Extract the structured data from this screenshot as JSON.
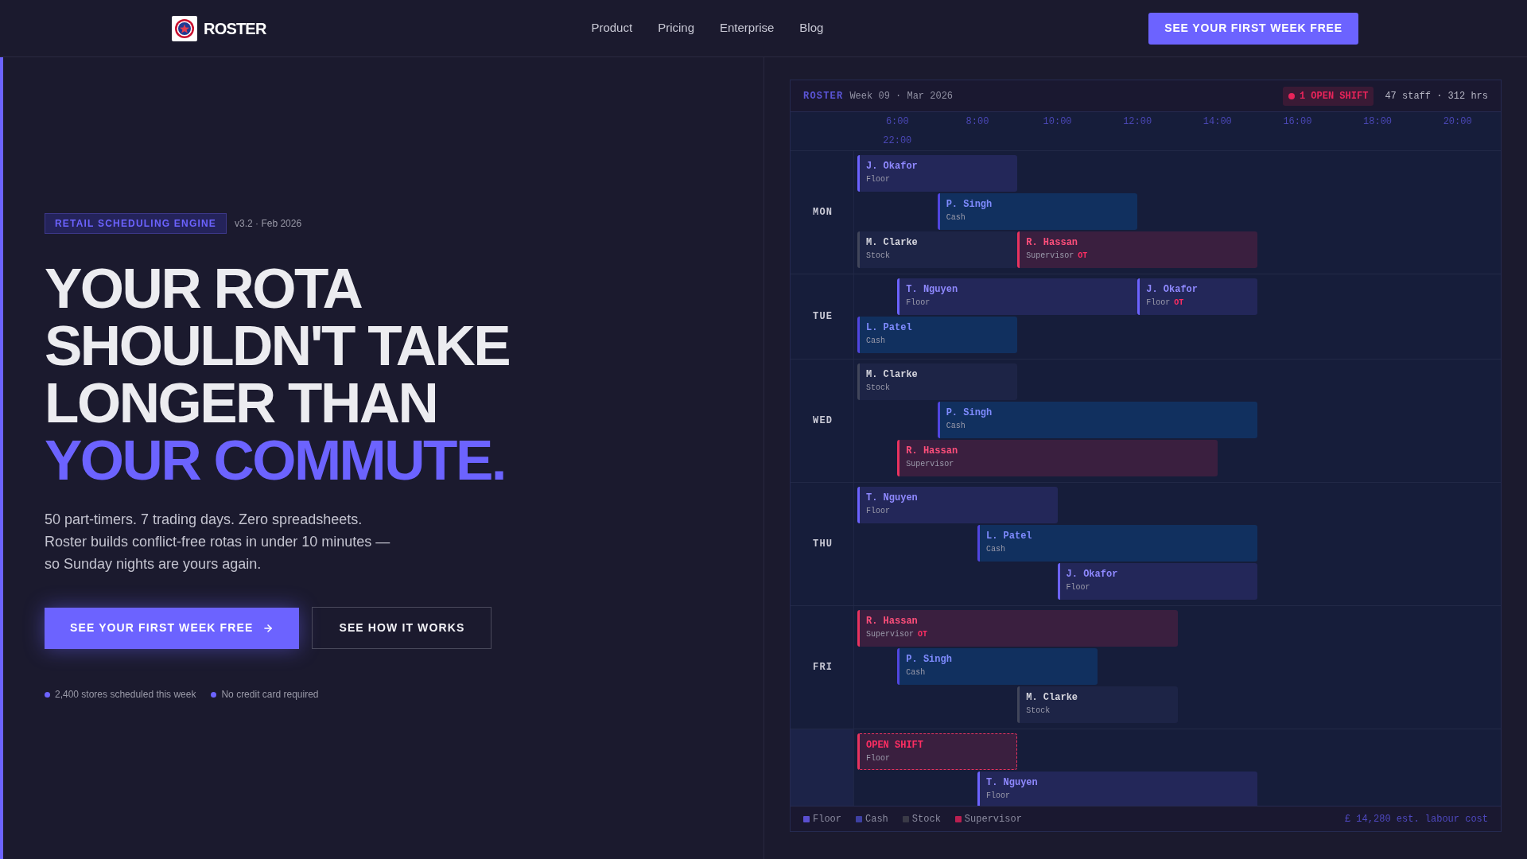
{
  "header": {
    "logo_text": "ROSTER",
    "nav": [
      "Product",
      "Pricing",
      "Enterprise",
      "Blog"
    ],
    "cta": "SEE YOUR FIRST WEEK FREE"
  },
  "hero": {
    "badge": "RETAIL SCHEDULING ENGINE",
    "version": "v3.2 · Feb 2026",
    "headline": [
      {
        "text": "YOUR ROTA",
        "accent": false
      },
      {
        "text": "SHOULDN'T TAKE",
        "accent": false
      },
      {
        "text": "LONGER THAN",
        "accent": false
      },
      {
        "text": "YOUR COMMUTE.",
        "accent": true
      }
    ],
    "description": "50 part-timers. 7 trading days. Zero spreadsheets. Roster builds conflict-free rotas in under 10 minutes — so Sunday nights are yours again.",
    "primary_button": "SEE YOUR FIRST WEEK FREE",
    "secondary_button": "SEE HOW IT WORKS",
    "highlights": [
      "2,400 stores scheduled this week",
      "No credit card required"
    ]
  },
  "schedule": {
    "brand": "ROSTER",
    "period": "Week 09 · Mar 2026",
    "alert": "1 OPEN SHIFT",
    "summary": "47 staff · 312 hrs",
    "time_labels": [
      "6:00",
      "8:00",
      "10:00",
      "12:00",
      "14:00",
      "16:00",
      "18:00",
      "20:00",
      "22:00"
    ],
    "days": [
      {
        "label": "MON",
        "highlighted": false,
        "lanes": [
          [
            {
              "name": "J. Okafor",
              "role": "Floor",
              "kind": "floor"
            }
          ],
          [
            {
              "name": "P. Singh",
              "role": "Cash",
              "kind": "cash"
            }
          ],
          [
            {
              "name": "M. Clarke",
              "role": "Stock",
              "kind": "stock"
            },
            {
              "name": "R. Hassan",
              "role": "Supervisor",
              "kind": "supervisor",
              "tag": "OT"
            }
          ]
        ]
      },
      {
        "label": "TUE",
        "highlighted": false,
        "lanes": [
          [
            {
              "name": "T. Nguyen",
              "role": "Floor",
              "kind": "floor"
            },
            {
              "name": "J. Okafor",
              "role": "Floor",
              "kind": "floor",
              "tag": "OT"
            }
          ],
          [
            {
              "name": "L. Patel",
              "role": "Cash",
              "kind": "cash"
            }
          ]
        ]
      },
      {
        "label": "WED",
        "highlighted": false,
        "lanes": [
          [
            {
              "name": "M. Clarke",
              "role": "Stock",
              "kind": "stock"
            }
          ],
          [
            {
              "name": "P. Singh",
              "role": "Cash",
              "kind": "cash"
            }
          ],
          [
            {
              "name": "R. Hassan",
              "role": "Supervisor",
              "kind": "supervisor"
            }
          ]
        ]
      },
      {
        "label": "THU",
        "highlighted": false,
        "lanes": [
          [
            {
              "name": "T. Nguyen",
              "role": "Floor",
              "kind": "floor"
            }
          ],
          [
            {
              "name": "L. Patel",
              "role": "Cash",
              "kind": "cash"
            }
          ],
          [
            {
              "name": "J. Okafor",
              "role": "Floor",
              "kind": "floor"
            }
          ]
        ]
      },
      {
        "label": "FRI",
        "highlighted": false,
        "lanes": [
          [
            {
              "name": "R. Hassan",
              "role": "Supervisor",
              "kind": "supervisor",
              "tag": "OT"
            }
          ],
          [
            {
              "name": "P. Singh",
              "role": "Cash",
              "kind": "cash"
            }
          ],
          [
            {
              "name": "M. Clarke",
              "role": "Stock",
              "kind": "stock"
            }
          ]
        ]
      },
      {
        "highlighted": true,
        "lanes": [
          [
            {
              "name": "OPEN SHIFT",
              "role": "Floor",
              "kind": "open"
            }
          ],
          [
            {
              "name": "T. Nguyen",
              "role": "Floor",
              "kind": "floor"
            }
          ]
        ]
      }
    ],
    "legend": [
      {
        "label": "Floor",
        "color": "#5a4fd0"
      },
      {
        "label": "Cash",
        "color": "#3e40a3"
      },
      {
        "label": "Stock",
        "color": "#3a3a47"
      },
      {
        "label": "Supervisor",
        "color": "#b91f50"
      }
    ],
    "cost": "£ 14,280 est. labour cost"
  }
}
